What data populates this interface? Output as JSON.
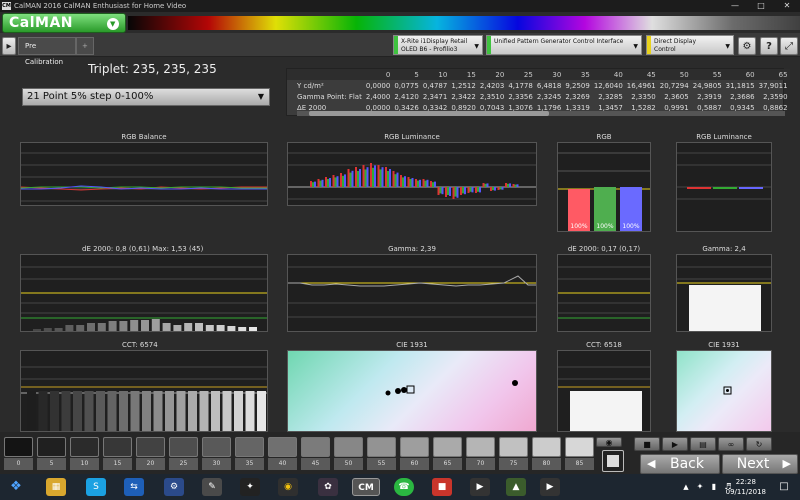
{
  "window": {
    "title": "CalMAN 2016 CalMAN Enthusiast for Home Video",
    "app_icon": "CM"
  },
  "logo": {
    "text": "CalMAN"
  },
  "toolbar": {
    "tab_label": "Pre Calibration",
    "add_tab": "+",
    "devices": [
      {
        "line1": "X-Rite i1Display Retail",
        "line2": "OLED B6 - Profilio3",
        "color": "#3fc23f"
      },
      {
        "line1": "Unified Pattern Generator Control Interface",
        "line2": "",
        "color": "#3fc23f"
      },
      {
        "line1": "Direct Display Control",
        "line2": "",
        "color": "#e8d21c"
      }
    ]
  },
  "triplet": "Triplet: 235, 235, 235",
  "step_select": "21 Point 5% step 0-100%",
  "table": {
    "columns": [
      "0",
      "5",
      "10",
      "15",
      "20",
      "25",
      "30",
      "35",
      "40",
      "45",
      "50",
      "55",
      "60",
      "65"
    ],
    "rows": [
      {
        "label": "Y cd/m²",
        "values": [
          "0,0000",
          "0,0775",
          "0,4787",
          "1,2512",
          "2,4203",
          "4,1778",
          "6,4818",
          "9,2509",
          "12,6040",
          "16,4961",
          "20,7294",
          "24,9805",
          "31,1815",
          "37,9011"
        ]
      },
      {
        "label": "Gamma Point: Flat",
        "values": [
          "2,4000",
          "2,4120",
          "2,3471",
          "2,3422",
          "2,3510",
          "2,3356",
          "2,3245",
          "2,3269",
          "2,3285",
          "2,3350",
          "2,3605",
          "2,3919",
          "2,3686",
          "2,3590"
        ]
      },
      {
        "label": "ΔE 2000",
        "values": [
          "0,0000",
          "0,3426",
          "0,3342",
          "0,8920",
          "0,7043",
          "1,3076",
          "1,1796",
          "1,3319",
          "1,3457",
          "1,5282",
          "0,9991",
          "0,5887",
          "0,9345",
          "0,8862"
        ]
      }
    ]
  },
  "panels": {
    "rgb_balance": "RGB Balance",
    "rgb_luminance": "RGB Luminance",
    "rgb": "RGB",
    "rgb_luminance2": "RGB Luminance",
    "de2000": "dE 2000:  0,8 (0,61)        Max: 1,53  (45)",
    "gamma": "Gamma: 2,39",
    "de2000_point": "dE 2000: 0,17 (0,17)",
    "gamma_point": "Gamma: 2,4",
    "cct": "CCT: 6574",
    "cie": "CIE 1931",
    "cct_point": "CCT: 6518",
    "cie_point": "CIE 1931"
  },
  "rgb_bars": {
    "labels": [
      "100%",
      "100%",
      "100%"
    ],
    "values": [
      100,
      100,
      100
    ],
    "colors": [
      "#ff5a64",
      "#4fae4f",
      "#6a6aff"
    ]
  },
  "gamma_point_level": 0.62,
  "swatches": [
    "0",
    "5",
    "10",
    "15",
    "20",
    "25",
    "30",
    "35",
    "40",
    "45",
    "50",
    "55",
    "60",
    "65",
    "70",
    "75",
    "80",
    "85"
  ],
  "nav": {
    "back": "Back",
    "next": "Next"
  },
  "clock": {
    "time": "22:28",
    "date": "09/11/2018"
  }
}
